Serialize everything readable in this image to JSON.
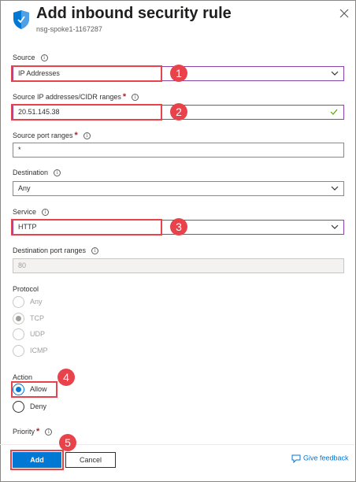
{
  "panel": {
    "title": "Add inbound security rule",
    "subtitle": "nsg-spoke1-1167287"
  },
  "fields": {
    "source": {
      "label": "Source",
      "value": "IP Addresses"
    },
    "source_ip": {
      "label": "Source IP addresses/CIDR ranges",
      "required": "*",
      "value": "20.51.145.38"
    },
    "source_port": {
      "label": "Source port ranges",
      "required": "*",
      "value": "*"
    },
    "destination": {
      "label": "Destination",
      "value": "Any"
    },
    "service": {
      "label": "Service",
      "value": "HTTP"
    },
    "dest_port": {
      "label": "Destination port ranges",
      "value": "80"
    },
    "protocol": {
      "label": "Protocol",
      "options": [
        "Any",
        "TCP",
        "UDP",
        "ICMP"
      ],
      "selected": "TCP"
    },
    "action": {
      "label": "Action",
      "options": [
        "Allow",
        "Deny"
      ],
      "selected": "Allow"
    },
    "priority": {
      "label": "Priority",
      "required": "*"
    }
  },
  "info_glyph": "i",
  "badges": [
    "1",
    "2",
    "3",
    "4",
    "5"
  ],
  "footer": {
    "add_label": "Add",
    "cancel_label": "Cancel",
    "feedback_label": "Give feedback"
  },
  "colors": {
    "accent": "#0078d4",
    "highlight": "#e8434b",
    "dropdown_border": "#8a44a8",
    "valid_check": "#57a300"
  },
  "icons": {
    "header": "shield-icon",
    "close": "close-icon",
    "dropdown": "chevron-down-icon",
    "valid": "checkmark-icon",
    "feedback": "feedback-icon",
    "info": "info-icon"
  }
}
